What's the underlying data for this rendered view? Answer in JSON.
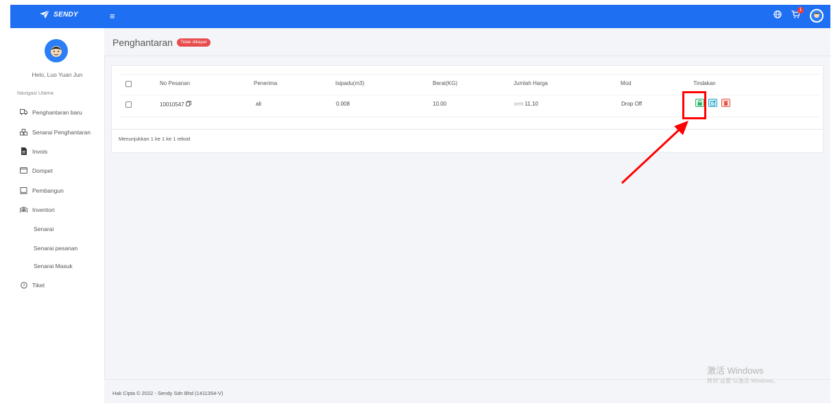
{
  "brand": {
    "name": "SENDY"
  },
  "topbar": {
    "cart_count": "1"
  },
  "sidebar": {
    "greeting": "Helo, Luo Yuan Jun",
    "nav_title": "Navigasi Utama",
    "items": [
      {
        "label": "Penghantaran baru",
        "icon": "truck-icon"
      },
      {
        "label": "Senarai Penghantaran",
        "icon": "boxes-icon"
      },
      {
        "label": "Invois",
        "icon": "invoice-icon"
      },
      {
        "label": "Dompet",
        "icon": "wallet-icon"
      },
      {
        "label": "Pembangun",
        "icon": "laptop-icon"
      },
      {
        "label": "Inventori",
        "icon": "warehouse-icon"
      }
    ],
    "sub_items": [
      {
        "label": "Senarai"
      },
      {
        "label": "Senarai pesanan"
      },
      {
        "label": "Senarai Masuk"
      }
    ],
    "ticket": {
      "label": "Tiket",
      "icon": "question-circle-icon"
    }
  },
  "page": {
    "title": "Penghantaran",
    "status_badge": "Tidak dibayar"
  },
  "table": {
    "columns": [
      "No Pesanan",
      "Penerima",
      "Isipadu(m3)",
      "Berat(KG)",
      "Jumlah Harga",
      "Mod",
      "Tindakan"
    ],
    "rows": [
      {
        "order_no": "10010547",
        "recipient": "ali",
        "volume": "0.008",
        "weight": "10.00",
        "currency": "MYR",
        "price": "11.10",
        "mode": "Drop Off"
      }
    ],
    "records_text": "Menunjukkan 1 ke 1 ke 1 rekod"
  },
  "footer": {
    "copyright": "Hak Cipta © 2022 - Sendy Sdn Bhd (1411354-V)"
  },
  "watermark": {
    "line1": "激活 Windows",
    "line2": "转到\"设置\"以激活 Windows。"
  },
  "colors": {
    "topbar": "#1f6ff2",
    "badge_red": "#e84c4c",
    "annotation_red": "#ff0000",
    "pay_green": "#27ae60",
    "edit_teal": "#17a2c8",
    "delete_red": "#e74c3c"
  }
}
